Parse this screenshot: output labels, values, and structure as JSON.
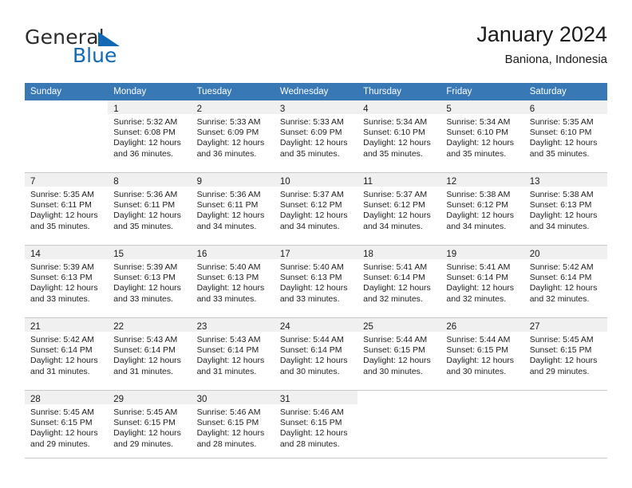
{
  "brand": {
    "name_part1": "General",
    "name_part2": "Blue",
    "logo_icon": "triangle-flag-icon"
  },
  "header": {
    "title": "January 2024",
    "subtitle": "Baniona, Indonesia"
  },
  "calendar": {
    "weekday_headers": [
      "Sunday",
      "Monday",
      "Tuesday",
      "Wednesday",
      "Thursday",
      "Friday",
      "Saturday"
    ],
    "colors": {
      "header_background": "#3878b4",
      "header_text": "#ffffff",
      "daynum_strip": "#f0f0f0",
      "grid_line": "#c8c8c8",
      "brand_blue": "#1268b3"
    },
    "weeks": [
      [
        {
          "day": "",
          "detail": "",
          "blank": true
        },
        {
          "day": "1",
          "detail": "Sunrise: 5:32 AM\nSunset: 6:08 PM\nDaylight: 12 hours\nand 36 minutes."
        },
        {
          "day": "2",
          "detail": "Sunrise: 5:33 AM\nSunset: 6:09 PM\nDaylight: 12 hours\nand 36 minutes."
        },
        {
          "day": "3",
          "detail": "Sunrise: 5:33 AM\nSunset: 6:09 PM\nDaylight: 12 hours\nand 35 minutes."
        },
        {
          "day": "4",
          "detail": "Sunrise: 5:34 AM\nSunset: 6:10 PM\nDaylight: 12 hours\nand 35 minutes."
        },
        {
          "day": "5",
          "detail": "Sunrise: 5:34 AM\nSunset: 6:10 PM\nDaylight: 12 hours\nand 35 minutes."
        },
        {
          "day": "6",
          "detail": "Sunrise: 5:35 AM\nSunset: 6:10 PM\nDaylight: 12 hours\nand 35 minutes."
        }
      ],
      [
        {
          "day": "7",
          "detail": "Sunrise: 5:35 AM\nSunset: 6:11 PM\nDaylight: 12 hours\nand 35 minutes."
        },
        {
          "day": "8",
          "detail": "Sunrise: 5:36 AM\nSunset: 6:11 PM\nDaylight: 12 hours\nand 35 minutes."
        },
        {
          "day": "9",
          "detail": "Sunrise: 5:36 AM\nSunset: 6:11 PM\nDaylight: 12 hours\nand 34 minutes."
        },
        {
          "day": "10",
          "detail": "Sunrise: 5:37 AM\nSunset: 6:12 PM\nDaylight: 12 hours\nand 34 minutes."
        },
        {
          "day": "11",
          "detail": "Sunrise: 5:37 AM\nSunset: 6:12 PM\nDaylight: 12 hours\nand 34 minutes."
        },
        {
          "day": "12",
          "detail": "Sunrise: 5:38 AM\nSunset: 6:12 PM\nDaylight: 12 hours\nand 34 minutes."
        },
        {
          "day": "13",
          "detail": "Sunrise: 5:38 AM\nSunset: 6:13 PM\nDaylight: 12 hours\nand 34 minutes."
        }
      ],
      [
        {
          "day": "14",
          "detail": "Sunrise: 5:39 AM\nSunset: 6:13 PM\nDaylight: 12 hours\nand 33 minutes."
        },
        {
          "day": "15",
          "detail": "Sunrise: 5:39 AM\nSunset: 6:13 PM\nDaylight: 12 hours\nand 33 minutes."
        },
        {
          "day": "16",
          "detail": "Sunrise: 5:40 AM\nSunset: 6:13 PM\nDaylight: 12 hours\nand 33 minutes."
        },
        {
          "day": "17",
          "detail": "Sunrise: 5:40 AM\nSunset: 6:13 PM\nDaylight: 12 hours\nand 33 minutes."
        },
        {
          "day": "18",
          "detail": "Sunrise: 5:41 AM\nSunset: 6:14 PM\nDaylight: 12 hours\nand 32 minutes."
        },
        {
          "day": "19",
          "detail": "Sunrise: 5:41 AM\nSunset: 6:14 PM\nDaylight: 12 hours\nand 32 minutes."
        },
        {
          "day": "20",
          "detail": "Sunrise: 5:42 AM\nSunset: 6:14 PM\nDaylight: 12 hours\nand 32 minutes."
        }
      ],
      [
        {
          "day": "21",
          "detail": "Sunrise: 5:42 AM\nSunset: 6:14 PM\nDaylight: 12 hours\nand 31 minutes."
        },
        {
          "day": "22",
          "detail": "Sunrise: 5:43 AM\nSunset: 6:14 PM\nDaylight: 12 hours\nand 31 minutes."
        },
        {
          "day": "23",
          "detail": "Sunrise: 5:43 AM\nSunset: 6:14 PM\nDaylight: 12 hours\nand 31 minutes."
        },
        {
          "day": "24",
          "detail": "Sunrise: 5:44 AM\nSunset: 6:14 PM\nDaylight: 12 hours\nand 30 minutes."
        },
        {
          "day": "25",
          "detail": "Sunrise: 5:44 AM\nSunset: 6:15 PM\nDaylight: 12 hours\nand 30 minutes."
        },
        {
          "day": "26",
          "detail": "Sunrise: 5:44 AM\nSunset: 6:15 PM\nDaylight: 12 hours\nand 30 minutes."
        },
        {
          "day": "27",
          "detail": "Sunrise: 5:45 AM\nSunset: 6:15 PM\nDaylight: 12 hours\nand 29 minutes."
        }
      ],
      [
        {
          "day": "28",
          "detail": "Sunrise: 5:45 AM\nSunset: 6:15 PM\nDaylight: 12 hours\nand 29 minutes."
        },
        {
          "day": "29",
          "detail": "Sunrise: 5:45 AM\nSunset: 6:15 PM\nDaylight: 12 hours\nand 29 minutes."
        },
        {
          "day": "30",
          "detail": "Sunrise: 5:46 AM\nSunset: 6:15 PM\nDaylight: 12 hours\nand 28 minutes."
        },
        {
          "day": "31",
          "detail": "Sunrise: 5:46 AM\nSunset: 6:15 PM\nDaylight: 12 hours\nand 28 minutes."
        },
        {
          "day": "",
          "detail": "",
          "blank": true
        },
        {
          "day": "",
          "detail": "",
          "blank": true
        },
        {
          "day": "",
          "detail": "",
          "blank": true
        }
      ]
    ]
  }
}
